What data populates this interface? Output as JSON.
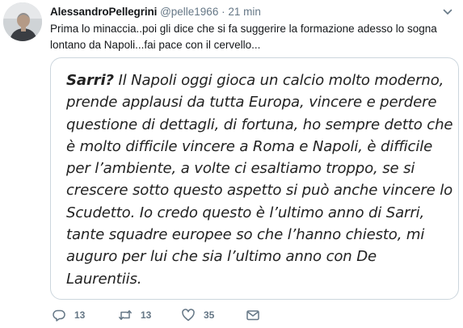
{
  "tweet": {
    "author": {
      "name": "AlessandroPellegrini",
      "handle": "@pelle1966"
    },
    "separator": "·",
    "time": "21 min",
    "text": "Prima lo minaccia..poi gli dice che si fa suggerire la formazione adesso lo sogna lontano da Napoli...fai pace con il cervello...",
    "image": {
      "lead": "Sarri?",
      "body": " Il Napoli oggi gioca un calcio molto moderno, prende applausi da tutta Europa, vincere e perdere questione di dettagli, di fortuna, ho sempre detto che è molto difficile vincere a Roma e Napoli, è difficile per l’ambiente, a volte ci esaltiamo troppo, se si crescere sotto questo aspetto si può anche vincere lo Scudetto. Io credo questo è l’ultimo anno di Sarri, tante squadre europee so che l’hanno chiesto, mi auguro per lui che sia l’ultimo anno con De Laurentiis."
    },
    "actions": {
      "replies": "13",
      "retweets": "13",
      "likes": "35"
    }
  },
  "icons": {
    "avatar": "profile-photo",
    "menu": "chevron-down-icon",
    "reply": "reply-icon",
    "retweet": "retweet-icon",
    "like": "heart-icon",
    "dm": "envelope-icon"
  },
  "colors": {
    "text": "#14171a",
    "secondary": "#657786",
    "border": "#ccd6dd"
  }
}
